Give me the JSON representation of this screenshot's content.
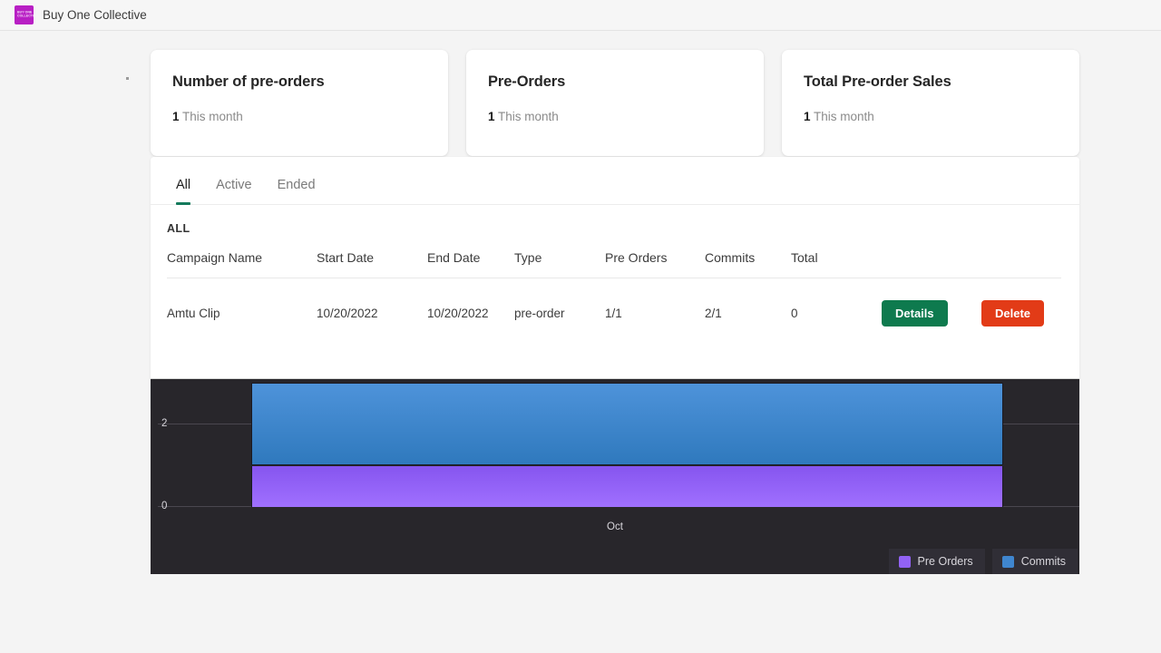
{
  "appbar": {
    "title": "Buy One Collective",
    "logo_glyph_top": "BUY ONE",
    "logo_glyph_bottom": "COLLECTIVE",
    "logo_color": "#b81fc4"
  },
  "cards": [
    {
      "title": "Number of pre-orders",
      "value": "1",
      "period": "This month"
    },
    {
      "title": "Pre-Orders",
      "value": "1",
      "period": "This month"
    },
    {
      "title": "Total Pre-order Sales",
      "value": "1",
      "period": "This month"
    }
  ],
  "tabs": [
    {
      "label": "All",
      "active": true
    },
    {
      "label": "Active",
      "active": false
    },
    {
      "label": "Ended",
      "active": false
    }
  ],
  "tabs_accent": "#147a5c",
  "table": {
    "section_label": "ALL",
    "headers": [
      "Campaign Name",
      "Start Date",
      "End Date",
      "Type",
      "Pre Orders",
      "Commits",
      "Total"
    ],
    "rows": [
      {
        "campaign_name": "Amtu Clip",
        "start_date": "10/20/2022",
        "end_date": "10/20/2022",
        "type": "pre-order",
        "pre_orders": "1/1",
        "commits": "2/1",
        "total": "0",
        "details_label": "Details",
        "delete_label": "Delete"
      }
    ],
    "details_color": "#0e7a4e",
    "delete_color": "#e23b17"
  },
  "chart_data": {
    "type": "bar",
    "stacked": true,
    "title": "",
    "xlabel": "",
    "ylabel": "",
    "categories": [
      "Oct"
    ],
    "x_tick_labels": [
      "Oct"
    ],
    "y_tick_labels": [
      "0",
      "2"
    ],
    "y_ticks": [
      0,
      2
    ],
    "ylim": [
      0,
      3
    ],
    "grid": true,
    "legend_position": "bottom-right",
    "background": "#28262b",
    "series": [
      {
        "name": "Pre Orders",
        "values": [
          1
        ],
        "color": "#9262f5"
      },
      {
        "name": "Commits",
        "values": [
          2
        ],
        "color": "#3f86cf"
      }
    ]
  }
}
